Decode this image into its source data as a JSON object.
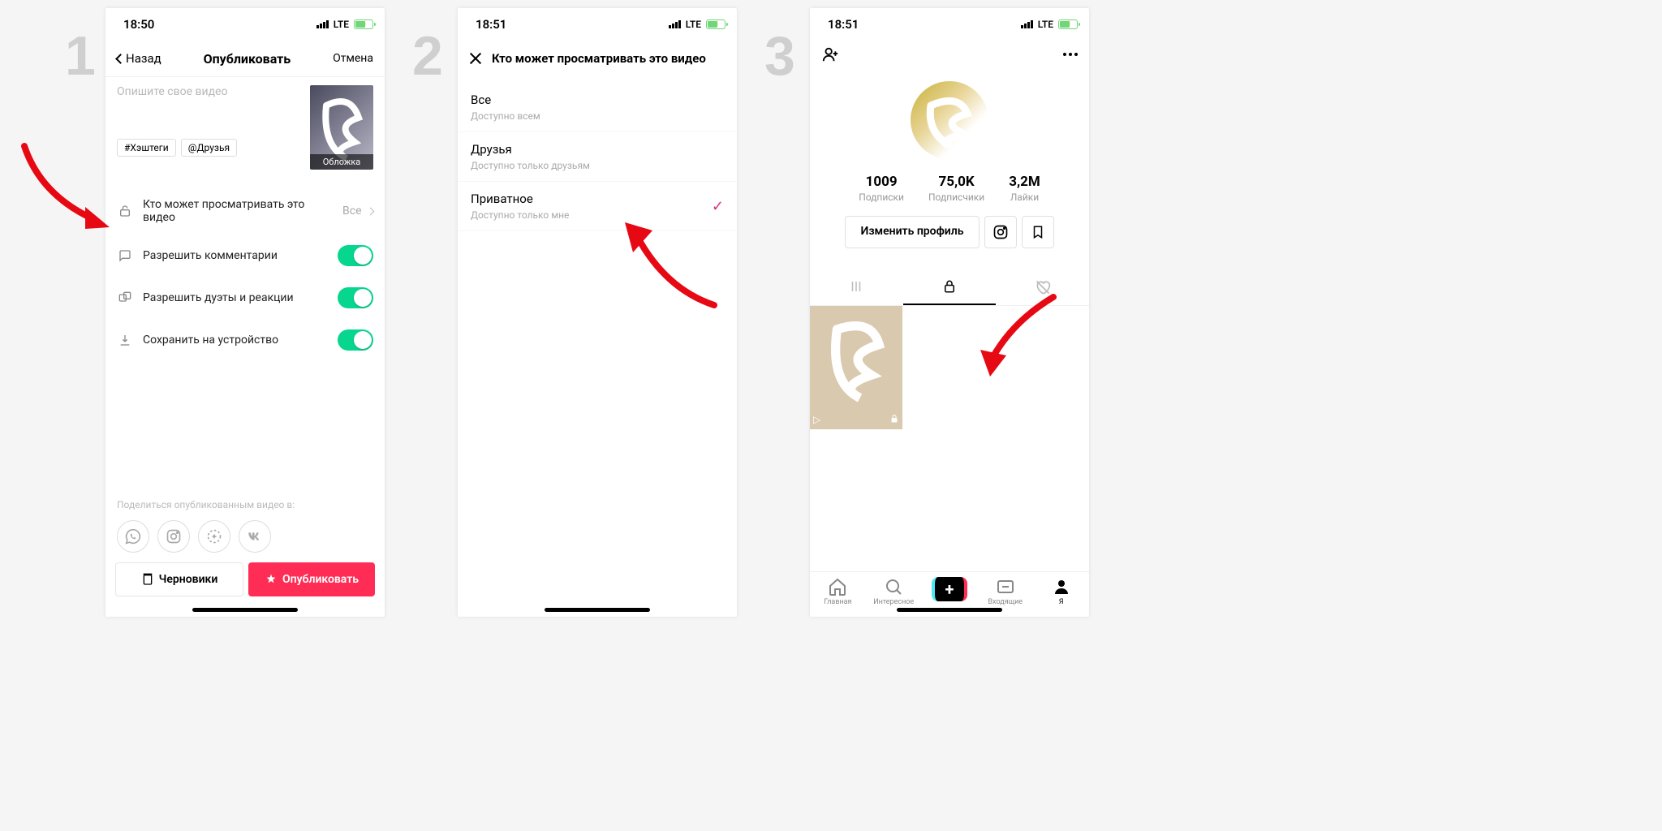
{
  "status": {
    "time1": "18:50",
    "time2": "18:51",
    "time3": "18:51",
    "network": "LTE"
  },
  "step_labels": {
    "s1": "1",
    "s2": "2",
    "s3": "3"
  },
  "screen1": {
    "back": "Назад",
    "title": "Опубликовать",
    "cancel": "Отмена",
    "placeholder": "Опишите свое видео",
    "hashtags_chip": "#Хэштеги",
    "friends_chip": "@Друзья",
    "cover_label": "Обложка",
    "who_can_view": "Кто может просматривать это видео",
    "who_value": "Все",
    "allow_comments": "Разрешить комментарии",
    "allow_duets": "Разрешить дуэты и реакции",
    "save_device": "Сохранить на устройство",
    "share_title": "Поделиться опубликованным видео в:",
    "drafts_btn": "Черновики",
    "publish_btn": "Опубликовать"
  },
  "screen2": {
    "title": "Кто может просматривать это видео",
    "options": [
      {
        "title": "Все",
        "sub": "Доступно всем",
        "checked": false
      },
      {
        "title": "Друзья",
        "sub": "Доступно только друзьям",
        "checked": false
      },
      {
        "title": "Приватное",
        "sub": "Доступно только мне",
        "checked": true
      }
    ]
  },
  "screen3": {
    "stats": [
      {
        "value": "1009",
        "label": "Подписки"
      },
      {
        "value": "75,0K",
        "label": "Подписчики"
      },
      {
        "value": "3,2M",
        "label": "Лайки"
      }
    ],
    "edit_profile": "Изменить профиль",
    "bottom_nav": [
      {
        "label": "Главная"
      },
      {
        "label": "Интересное"
      },
      {
        "label": ""
      },
      {
        "label": "Входящие"
      },
      {
        "label": "Я"
      }
    ]
  }
}
